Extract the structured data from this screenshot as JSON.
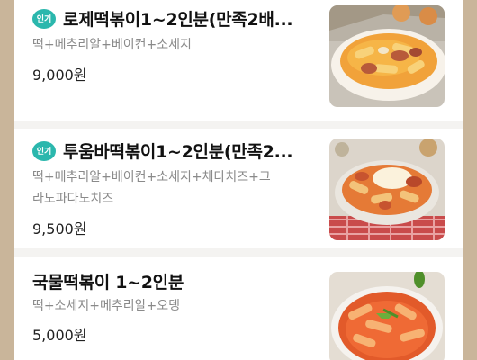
{
  "menu": {
    "items": [
      {
        "badge": "인기",
        "name": "로제떡볶이1~2인분(만족2배...",
        "description": "떡+메추리알+베이컨+소세지",
        "price": "9,000원",
        "image": "rose-tteokbokki-photo"
      },
      {
        "badge": "인기",
        "name": "투움바떡볶이1~2인분(만족2...",
        "description": "떡+메추리알+베이컨+소세지+체다치즈+그라노파다노치즈",
        "description_line1": "떡+메추리알+베이컨+소세지+체다치즈+그",
        "description_line2": "라노파다노치즈",
        "price": "9,500원",
        "image": "toowoomba-tteokbokki-photo"
      },
      {
        "name": "국물떡볶이 1~2인분",
        "description": "떡+소세지+메추리알+오뎅",
        "price": "5,000원",
        "image": "soup-tteokbokki-photo"
      }
    ]
  },
  "colors": {
    "background": "#c9b59a",
    "badge": "#2bb7ad",
    "title": "#111111",
    "description": "#8a8a8a",
    "price": "#222222"
  }
}
